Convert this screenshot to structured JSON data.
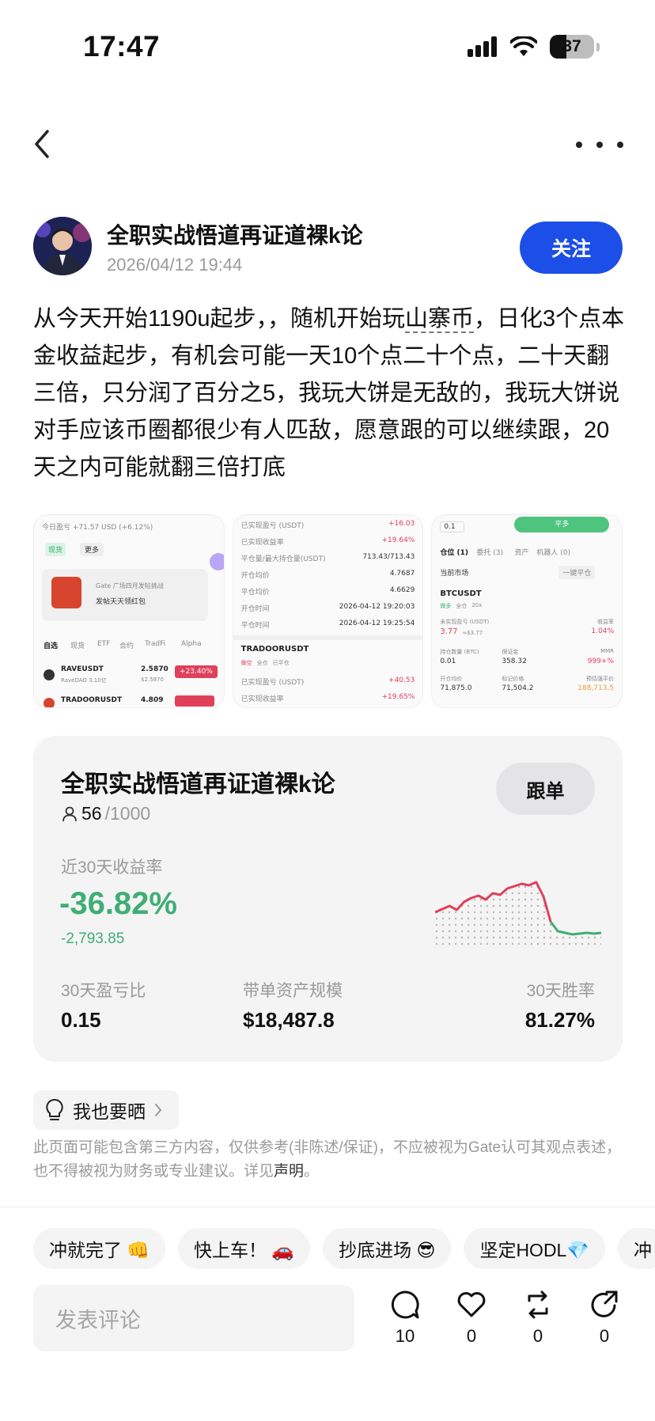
{
  "status_bar": {
    "time": "17:47",
    "battery": "37"
  },
  "author": {
    "name": "全职实战悟道再证道裸k论",
    "date": "2026/04/12 19:44",
    "follow_label": "关注"
  },
  "post": {
    "text_before": "从今天开始1190u起步，，随机开始玩",
    "text_highlight": "山寨币",
    "text_after": "，日化3个点本金收益起步，有机会可能一天10个点二十个点，二十天翻三倍，只分润了百分之5，我玩大饼是无敌的，我玩大饼说对手应该币圈都很少有人匹敌，愿意跟的可以继续跟，20天之内可能就翻三倍打底"
  },
  "images": {
    "img1": {
      "header": "今日盈亏 +71.57 USD (+6.12%)",
      "btn_a": "现货",
      "btn_b": "更多",
      "promo_a": "Gate 广场四月发帖挑战",
      "promo_b": "发帖天天领红包",
      "tabs": [
        "自选",
        "现货",
        "ETF",
        "合约",
        "TradFi",
        "Alpha"
      ],
      "row1": {
        "sym": "RAVEUSDT",
        "sub": "RaveDAO 3.10亿",
        "price": "2.5870",
        "sub_price": "$2.5870",
        "chg": "+23.40%"
      },
      "row2": {
        "sym": "TRADOORUSDT",
        "price": "4.809"
      }
    },
    "img2": {
      "rows": [
        {
          "k": "已实现盈亏 (USDT)",
          "v": "+16.03",
          "red": true
        },
        {
          "k": "已实现收益率",
          "v": "+19.64%",
          "red": true
        },
        {
          "k": "平仓量/最大持仓量(USDT)",
          "v": "713.43/713.43",
          "red": false
        },
        {
          "k": "开仓均价",
          "v": "4.7687",
          "red": false
        },
        {
          "k": "平仓均价",
          "v": "4.6629",
          "red": false
        },
        {
          "k": "开仓时间",
          "v": "2026-04-12 19:20:03",
          "red": false
        },
        {
          "k": "平仓时间",
          "v": "2026-04-12 19:25:54",
          "red": false
        }
      ],
      "symbol": "TRADOORUSDT",
      "tags": [
        "做空",
        "全仓",
        "已平仓"
      ],
      "rows2": [
        {
          "k": "已实现盈亏 (USDT)",
          "v": "+40.53"
        },
        {
          "k": "已实现收益率",
          "v": "+19.65%"
        }
      ]
    },
    "img3": {
      "top_val": "0.1",
      "top_btn": "平多",
      "tabs": [
        "仓位 (1)",
        "委托 (3)",
        "资产",
        "机器人 (0)"
      ],
      "filter": "当前市场",
      "close_all": "一键平仓",
      "symbol": "BTCUSDT",
      "tags": [
        "做多",
        "全仓",
        "20x"
      ],
      "pnl_label": "未实现盈亏 (USDT)",
      "pnl": "3.77",
      "pnl_sub": "≈$3.77",
      "roe_label": "收益率",
      "roe": "1.04%",
      "qty_label": "持仓数量 (BTC)",
      "margin_label": "保证金",
      "mmr_label": "MMR",
      "qty": "0.01",
      "margin": "358.32",
      "mmr": "999+%",
      "open_label": "开仓均价",
      "mark_label": "标记价格",
      "liq_label": "预估强平价",
      "open": "71,875.0",
      "mark": "71,504.2",
      "liq": "188,713.5"
    }
  },
  "stats": {
    "title": "全职实战悟道再证道裸k论",
    "copy_label": "跟单",
    "followers": "56",
    "followers_max": "/1000",
    "roi_label": "近30天收益率",
    "roi": "-36.82%",
    "roi_abs": "-2,793.85",
    "m1_label": "30天盈亏比",
    "m1_value": "0.15",
    "m2_label": "带单资产规模",
    "m2_value": "$18,487.8",
    "m3_label": "30天胜率",
    "m3_value": "81.27%",
    "sparkline": [
      0.42,
      0.46,
      0.5,
      0.45,
      0.55,
      0.6,
      0.63,
      0.58,
      0.66,
      0.64,
      0.72,
      0.75,
      0.78,
      0.76,
      0.8,
      0.62,
      0.3,
      0.18,
      0.16,
      0.14,
      0.15,
      0.16,
      0.15,
      0.16
    ]
  },
  "share": {
    "label": "我也要晒"
  },
  "disclaimer": {
    "text": "此页面可能包含第三方内容，仅供参考(非陈述/保证)，不应被视为Gate认可其观点表述，也不得被视为财务或专业建议。详见",
    "link": "声明",
    "end": "。"
  },
  "chips": [
    "冲就完了 👊",
    "快上车！ 🚗",
    "抄底进场 😎",
    "坚定HODL💎",
    "冲"
  ],
  "bottom": {
    "comment_placeholder": "发表评论",
    "comments": "10",
    "likes": "0",
    "reposts": "0",
    "shares": "0"
  },
  "colors": {
    "follow": "#1c4ee8",
    "loss_green": "#3fae74",
    "chart_red": "#e0405a"
  }
}
